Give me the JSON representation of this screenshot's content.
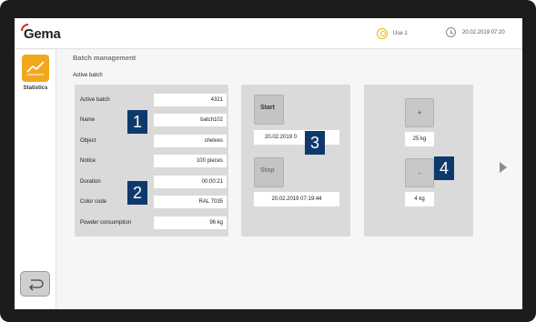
{
  "header": {
    "logo": "Gema",
    "user": "Use 1",
    "datetime": "20.02.2019 07:20"
  },
  "sidebar": {
    "statistics_label": "Statistics"
  },
  "page": {
    "section_title": "Batch management",
    "sub_title": "Active batch"
  },
  "batch": {
    "rows": [
      {
        "label": "Active batch",
        "value": "4321"
      },
      {
        "label": "Name",
        "value": "batch102"
      },
      {
        "label": "Object",
        "value": "shelves"
      },
      {
        "label": "Notice",
        "value": "100 pieces"
      },
      {
        "label": "Duration",
        "value": "00:00:21"
      },
      {
        "label": "Color code",
        "value": "RAL 7035"
      },
      {
        "label": "Powder consumption",
        "value": "96 kg"
      }
    ]
  },
  "control": {
    "start_label": "Start",
    "start_time": "20.02.2019 0",
    "stop_label": "Stop",
    "stop_time": "20.02.2019 07:19:44"
  },
  "stepper": {
    "plus_label": "+",
    "upper_value": "25 kg",
    "minus_label": "-",
    "lower_value": "4 kg"
  },
  "markers": [
    "1",
    "2",
    "3",
    "4"
  ],
  "colors": {
    "accent": "#f2a81c",
    "marker": "#0e3a6b",
    "brand_red": "#d8261c"
  }
}
